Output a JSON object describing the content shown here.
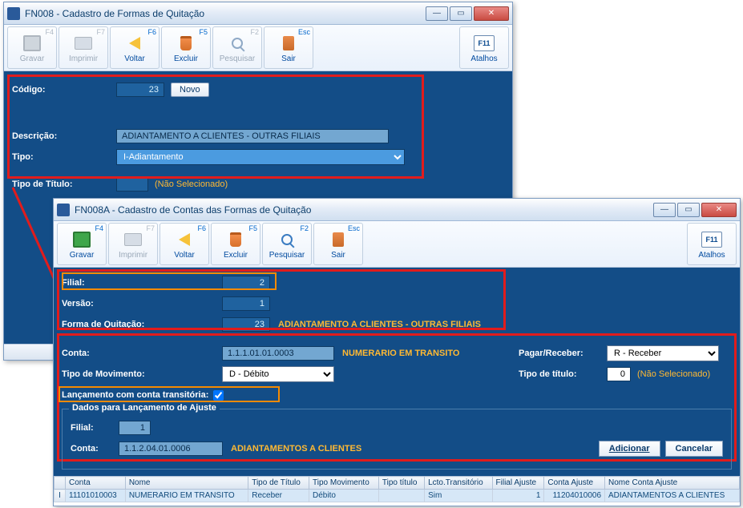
{
  "win1": {
    "title": "FN008 - Cadastro de Formas de Quitação",
    "toolbar": {
      "gravar": "Gravar",
      "gravar_key": "F4",
      "imprimir": "Imprimir",
      "imprimir_key": "F7",
      "voltar": "Voltar",
      "voltar_key": "F6",
      "excluir": "Excluir",
      "excluir_key": "F5",
      "pesquisar": "Pesquisar",
      "pesquisar_key": "F2",
      "sair": "Sair",
      "sair_key": "Esc",
      "atalhos": "Atalhos",
      "atalhos_key": "F11"
    },
    "form": {
      "codigo_label": "Código:",
      "codigo_value": "23",
      "novo_btn": "Novo",
      "descricao_label": "Descrição:",
      "descricao_value": "ADIANTAMENTO A CLIENTES - OUTRAS FILIAIS",
      "tipo_label": "Tipo:",
      "tipo_value": "I-Adiantamento",
      "tipo_titulo_label": "Tipo de Título:",
      "tipo_titulo_value": "",
      "nao_selecionado": "(Não Selecionado)"
    }
  },
  "win2": {
    "title": "FN008A - Cadastro de Contas das Formas de Quitação",
    "toolbar": {
      "gravar": "Gravar",
      "gravar_key": "F4",
      "imprimir": "Imprimir",
      "imprimir_key": "F7",
      "voltar": "Voltar",
      "voltar_key": "F6",
      "excluir": "Excluir",
      "excluir_key": "F5",
      "pesquisar": "Pesquisar",
      "pesquisar_key": "F2",
      "sair": "Sair",
      "sair_key": "Esc",
      "atalhos": "Atalhos",
      "atalhos_key": "F11"
    },
    "form": {
      "filial_label": "Filial:",
      "filial_value": "2",
      "versao_label": "Versão:",
      "versao_value": "1",
      "forma_label": "Forma de Quitação:",
      "forma_value": "23",
      "forma_text": "ADIANTAMENTO A CLIENTES - OUTRAS FILIAIS",
      "conta_label": "Conta:",
      "conta_value": "1.1.1.01.01.0003",
      "conta_text": "NUMERARIO EM TRANSITO",
      "tipomov_label": "Tipo de Movimento:",
      "tipomov_value": "D - Débito",
      "lanc_trans_label": "Lançamento com conta transitória:",
      "pr_label": "Pagar/Receber:",
      "pr_value": "R - Receber",
      "tt_label": "Tipo de título:",
      "tt_value": "0",
      "tt_text": "(Não Selecionado)",
      "ajuste_legend": "Dados para Lançamento de Ajuste",
      "aj_filial_label": "Filial:",
      "aj_filial_value": "1",
      "aj_conta_label": "Conta:",
      "aj_conta_value": "1.1.2.04.01.0006",
      "aj_conta_text": "ADIANTAMENTOS A CLIENTES",
      "adicionar": "Adicionar",
      "cancelar": "Cancelar"
    },
    "grid": {
      "headers": {
        "conta": "Conta",
        "nome": "Nome",
        "tipotitulo": "Tipo de Título",
        "tipomov": "Tipo Movimento",
        "tipotit2": "Tipo título",
        "lctotrans": "Lcto.Transitório",
        "filialaj": "Filial Ajuste",
        "contaaj": "Conta Ajuste",
        "nomecontaaj": "Nome Conta Ajuste"
      },
      "rows": [
        {
          "conta": "11101010003",
          "nome": "NUMERARIO EM TRANSITO",
          "tipotitulo": "Receber",
          "tipomov": "Débito",
          "tipotit2": "",
          "lctotrans": "Sim",
          "filialaj": "1",
          "contaaj": "11204010006",
          "nomecontaaj": "ADIANTAMENTOS A CLIENTES"
        }
      ]
    }
  }
}
